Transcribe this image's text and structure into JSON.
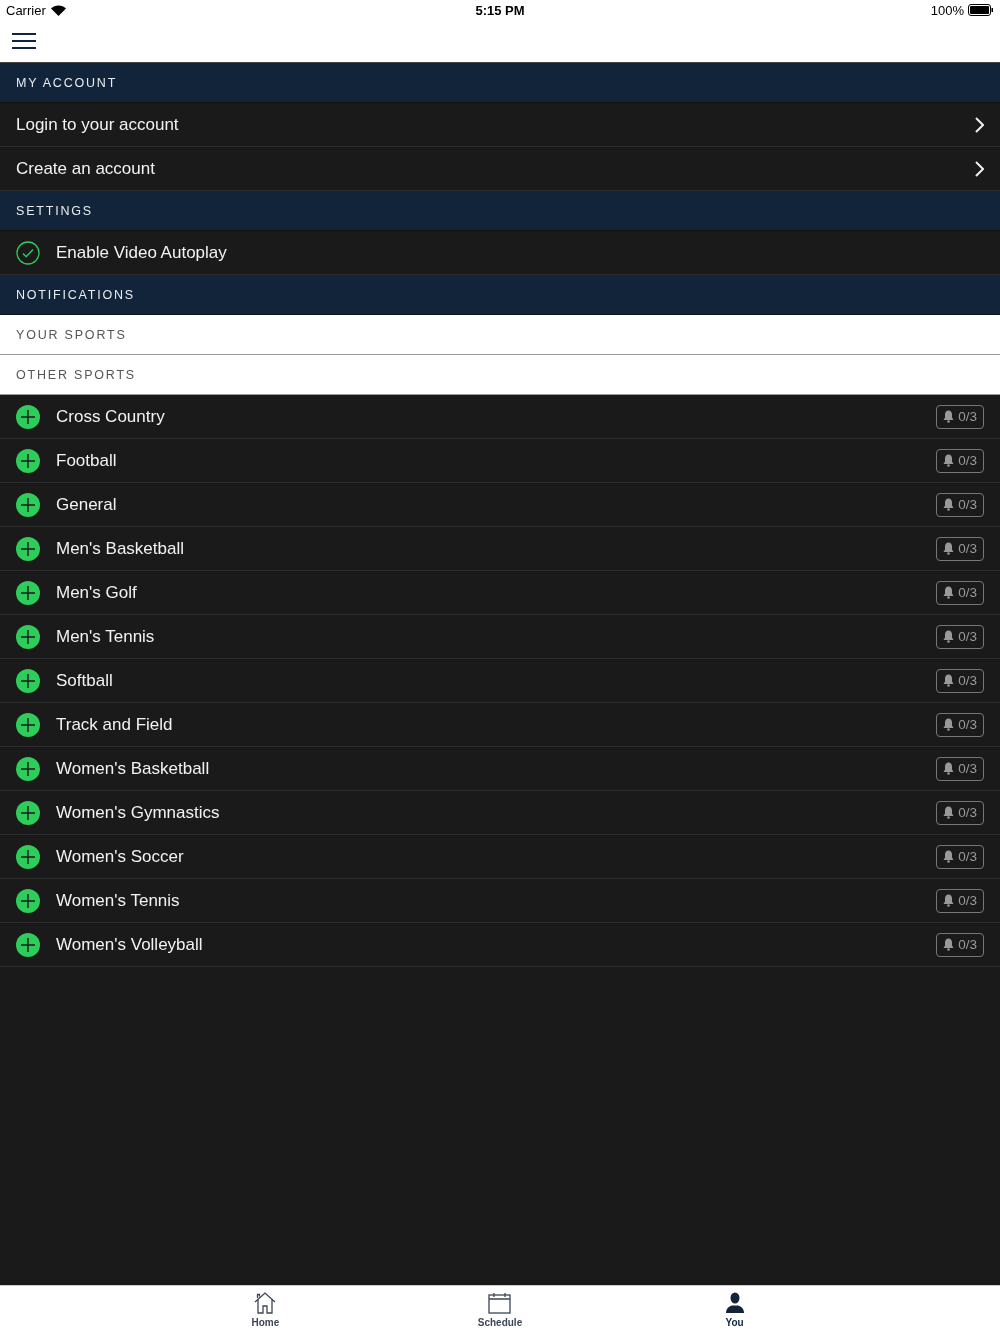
{
  "status_bar": {
    "carrier": "Carrier",
    "time": "5:15 PM",
    "battery": "100%"
  },
  "sections": [
    {
      "title": "MY ACCOUNT",
      "kind": "dark",
      "rows": [
        {
          "kind": "link",
          "label": "Login to your account"
        },
        {
          "kind": "link",
          "label": "Create an account"
        }
      ]
    },
    {
      "title": "SETTINGS",
      "kind": "dark",
      "rows": [
        {
          "kind": "toggle",
          "label": "Enable Video Autoplay",
          "checked": true
        }
      ]
    },
    {
      "title": "NOTIFICATIONS",
      "kind": "dark"
    },
    {
      "title": "YOUR SPORTS",
      "kind": "light"
    },
    {
      "title": "OTHER SPORTS",
      "kind": "light",
      "rows": [
        {
          "kind": "sport",
          "label": "Cross Country",
          "count": "0/3"
        },
        {
          "kind": "sport",
          "label": "Football",
          "count": "0/3"
        },
        {
          "kind": "sport",
          "label": "General",
          "count": "0/3"
        },
        {
          "kind": "sport",
          "label": "Men's Basketball",
          "count": "0/3"
        },
        {
          "kind": "sport",
          "label": "Men's Golf",
          "count": "0/3"
        },
        {
          "kind": "sport",
          "label": "Men's Tennis",
          "count": "0/3"
        },
        {
          "kind": "sport",
          "label": "Softball",
          "count": "0/3"
        },
        {
          "kind": "sport",
          "label": "Track and Field",
          "count": "0/3"
        },
        {
          "kind": "sport",
          "label": "Women's Basketball",
          "count": "0/3"
        },
        {
          "kind": "sport",
          "label": "Women's Gymnastics",
          "count": "0/3"
        },
        {
          "kind": "sport",
          "label": "Women's Soccer",
          "count": "0/3"
        },
        {
          "kind": "sport",
          "label": "Women's Tennis",
          "count": "0/3"
        },
        {
          "kind": "sport",
          "label": "Women's Volleyball",
          "count": "0/3"
        }
      ]
    }
  ],
  "tabs": [
    {
      "label": "Home",
      "kind": "home",
      "selected": false
    },
    {
      "label": "Schedule",
      "kind": "calendar",
      "selected": false
    },
    {
      "label": "You",
      "kind": "person",
      "selected": true
    }
  ]
}
